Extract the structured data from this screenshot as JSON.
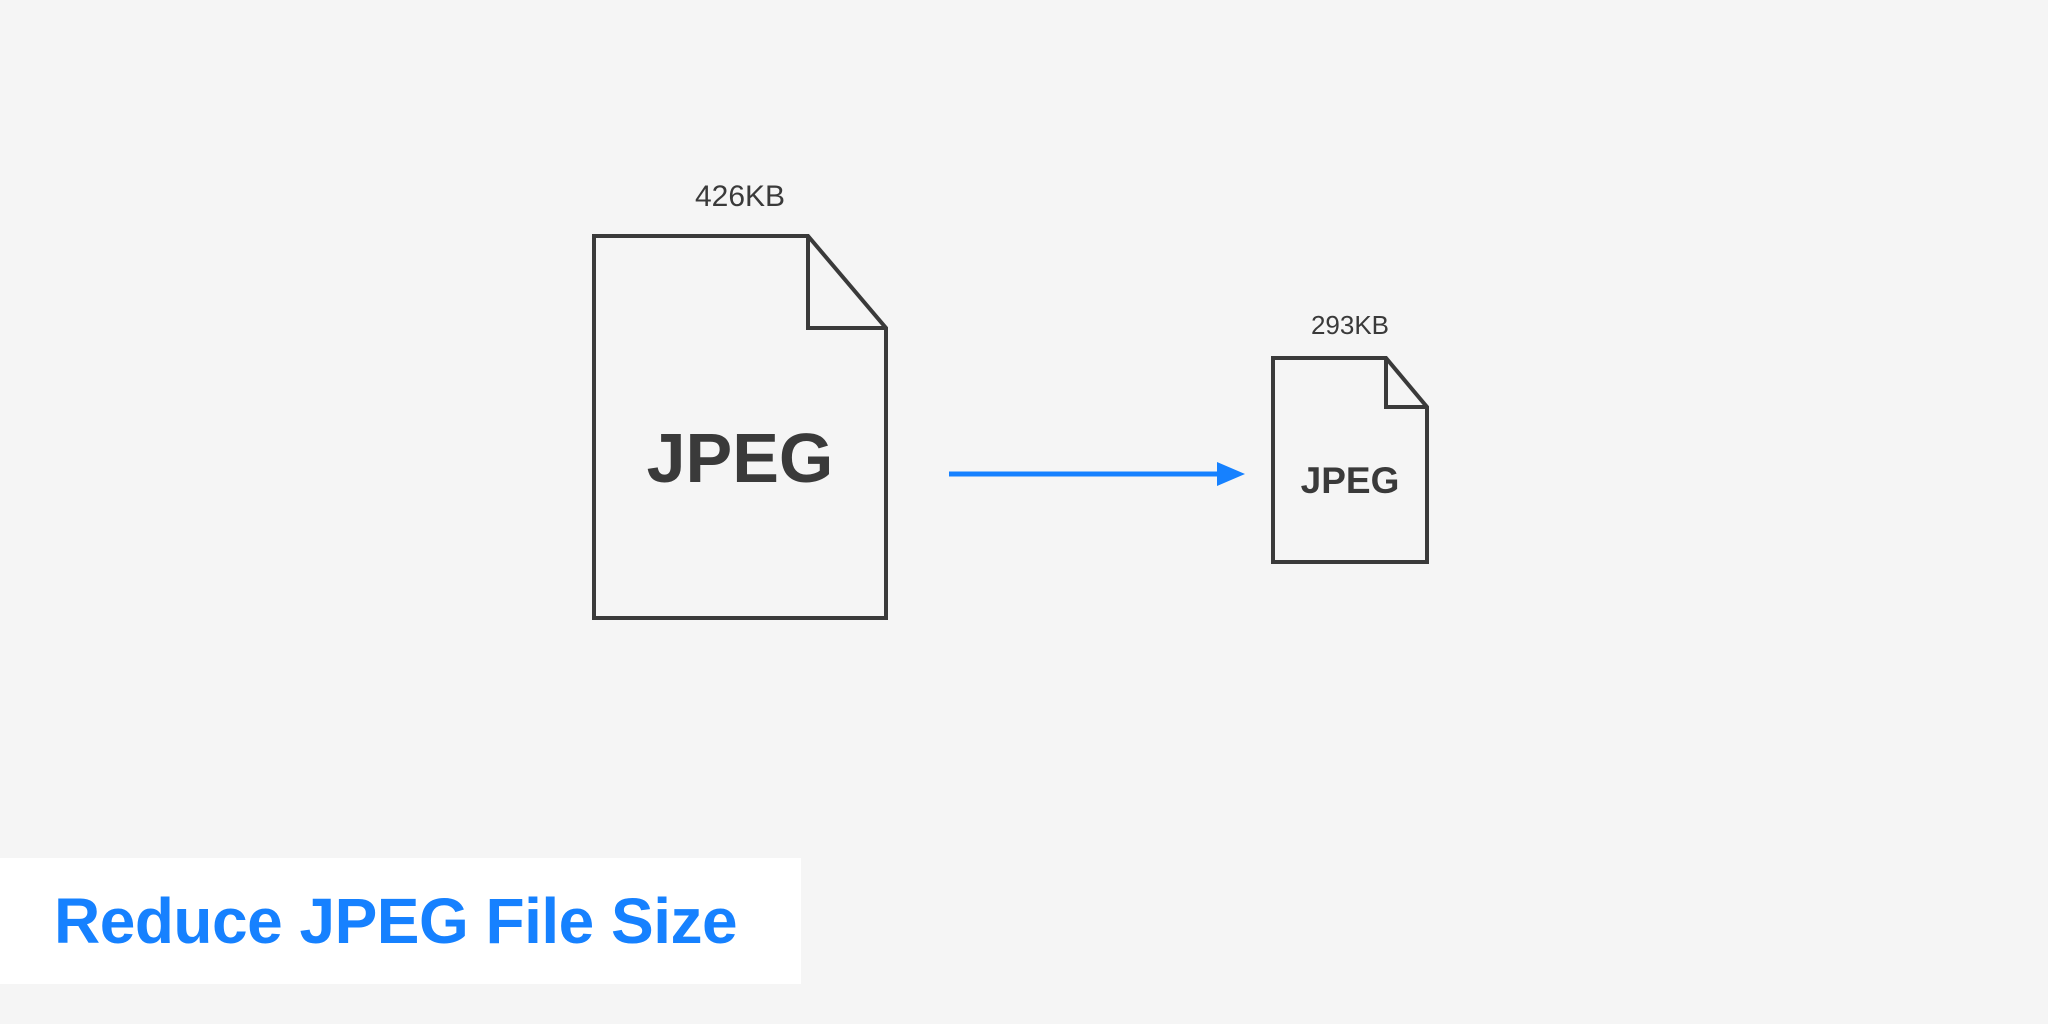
{
  "bigFile": {
    "sizeLabel": "426KB",
    "format": "JPEG"
  },
  "smallFile": {
    "sizeLabel": "293KB",
    "format": "JPEG"
  },
  "title": "Reduce JPEG File Size",
  "colors": {
    "accent": "#1681ff",
    "stroke": "#3a3a3a",
    "bg": "#f5f5f5",
    "titleBg": "#ffffff"
  }
}
